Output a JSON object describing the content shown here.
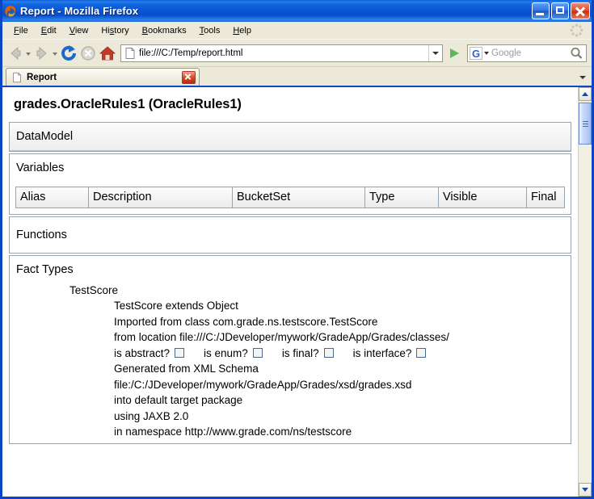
{
  "window": {
    "title": "Report - Mozilla Firefox",
    "app_icon": "firefox-logo-icon",
    "minimize_label": "Minimize",
    "maximize_label": "Maximize",
    "close_label": "Close"
  },
  "menubar": {
    "items": [
      {
        "label": "File",
        "accel": "F"
      },
      {
        "label": "Edit",
        "accel": "E"
      },
      {
        "label": "View",
        "accel": "V"
      },
      {
        "label": "History",
        "accel": "s"
      },
      {
        "label": "Bookmarks",
        "accel": "B"
      },
      {
        "label": "Tools",
        "accel": "T"
      },
      {
        "label": "Help",
        "accel": "H"
      }
    ],
    "throbber_icon": "throbber-icon"
  },
  "toolbar": {
    "back_icon": "back-arrow-icon",
    "forward_icon": "forward-arrow-icon",
    "reload_icon": "reload-icon",
    "stop_icon": "stop-icon",
    "home_icon": "home-icon",
    "go_icon": "go-arrow-icon"
  },
  "urlbar": {
    "favicon": "page-icon",
    "value": "file:///C:/Temp/report.html",
    "dropdown_icon": "chevron-down-icon"
  },
  "searchbar": {
    "engine_icon": "google-g-icon",
    "engine_letter": "G",
    "dropdown_icon": "chevron-down-icon",
    "placeholder": "Google",
    "search_icon": "magnifier-icon"
  },
  "tabs": [
    {
      "favicon": "page-icon",
      "label": "Report",
      "close_icon": "close-icon",
      "active": true
    }
  ],
  "tabbar": {
    "list_all_icon": "chevron-down-icon"
  },
  "page": {
    "title": "grades.OracleRules1 (OracleRules1)",
    "sections": [
      {
        "id": "datamodel",
        "heading": "DataModel"
      },
      {
        "id": "variables",
        "heading": "Variables"
      },
      {
        "id": "functions",
        "heading": "Functions"
      },
      {
        "id": "facttypes",
        "heading": "Fact Types"
      }
    ],
    "variables_table": {
      "columns": [
        "Alias",
        "Description",
        "BucketSet",
        "Type",
        "Visible",
        "Final"
      ],
      "rows": []
    },
    "fact_types": [
      {
        "name": "TestScore",
        "lines": [
          "TestScore extends Object",
          "Imported from class com.grade.ns.testscore.TestScore",
          "from location file:///C:/JDeveloper/mywork/GradeApp/Grades/classes/"
        ],
        "flags": [
          {
            "label": "is abstract?",
            "checked": false
          },
          {
            "label": "is enum?",
            "checked": false
          },
          {
            "label": "is final?",
            "checked": false
          },
          {
            "label": "is interface?",
            "checked": false
          }
        ],
        "lines_after": [
          "Generated from XML Schema",
          "file:/C:/JDeveloper/mywork/GradeApp/Grades/xsd/grades.xsd",
          "into default target package",
          "using JAXB 2.0",
          "in namespace http://www.grade.com/ns/testscore"
        ]
      }
    ]
  },
  "scrollbar": {
    "up_icon": "chevron-up-icon",
    "down_icon": "chevron-down-icon",
    "thumb_label": "vertical-scroll-thumb"
  },
  "colors": {
    "titlebar_blue": "#0b55d4",
    "frame_blue": "#0a46c4",
    "chrome_beige": "#ece9d8",
    "panel_border": "#95a5b2",
    "close_red": "#c92f14"
  }
}
